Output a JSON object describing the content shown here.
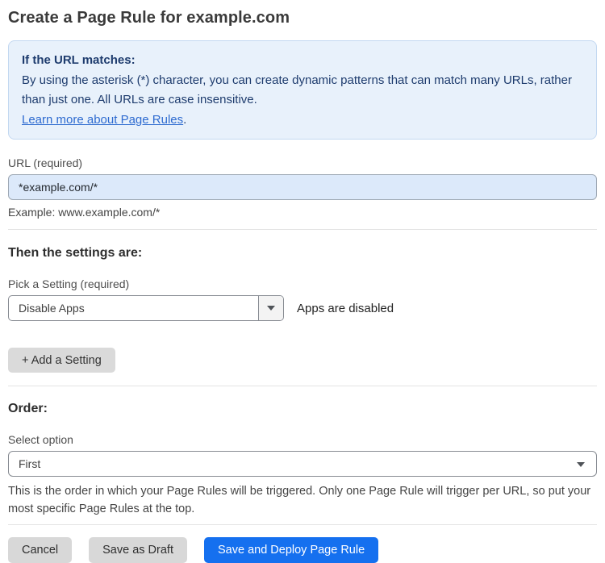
{
  "page": {
    "title": "Create a Page Rule for example.com"
  },
  "info_box": {
    "heading": "If the URL matches:",
    "body": "By using the asterisk (*) character, you can create dynamic patterns that can match many URLs, rather than just one. All URLs are case insensitive.",
    "link_label": "Learn more about Page Rules",
    "link_suffix": "."
  },
  "url_field": {
    "label": "URL (required)",
    "value": "*example.com/*",
    "helper": "Example: www.example.com/*"
  },
  "settings_section": {
    "heading": "Then the settings are:",
    "setting_label": "Pick a Setting (required)",
    "setting_value": "Disable Apps",
    "setting_status": "Apps are disabled",
    "add_setting_label": "+ Add a Setting"
  },
  "order_section": {
    "heading": "Order:",
    "select_label": "Select option",
    "select_value": "First",
    "helper": "This is the order in which your Page Rules will be triggered. Only one Page Rule will trigger per URL, so put your most specific Page Rules at the top."
  },
  "actions": {
    "cancel": "Cancel",
    "save_draft": "Save as Draft",
    "save_deploy": "Save and Deploy Page Rule"
  },
  "colors": {
    "info_bg": "#e8f1fb",
    "info_border": "#c3d8f1",
    "info_text": "#1e3c6e",
    "link": "#2e6bd0",
    "input_bg": "#dce9fa",
    "primary_button": "#1570ef",
    "secondary_button": "#d8d8d8"
  }
}
